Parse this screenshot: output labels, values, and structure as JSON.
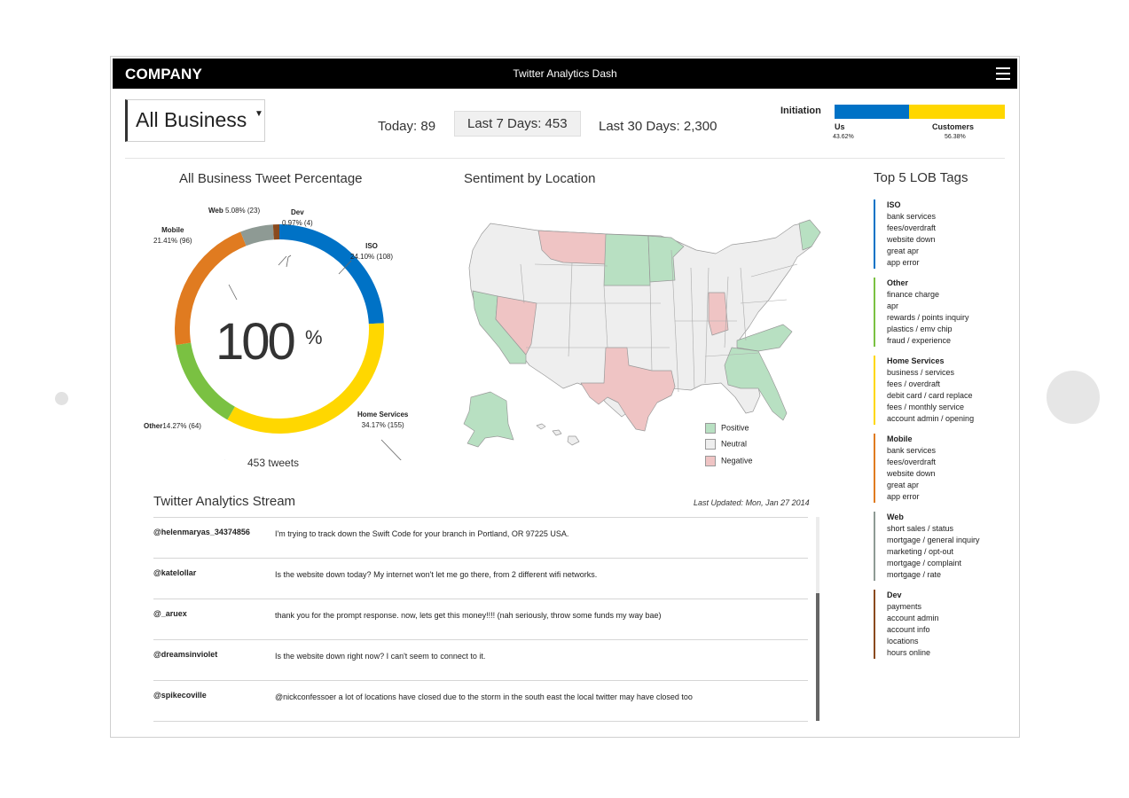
{
  "header": {
    "brand": "COMPANY",
    "title": "Twitter Analytics Dash",
    "menu_icon": "hamburger-menu-icon"
  },
  "business_select": {
    "value": "All Business"
  },
  "ranges": [
    {
      "label": "Today: 89",
      "selected": false
    },
    {
      "label": "Last 7 Days: 453",
      "selected": true
    },
    {
      "label": "Last 30 Days: 2,300",
      "selected": false
    }
  ],
  "initiation": {
    "label": "Initiation",
    "segments": [
      {
        "name": "Us",
        "percent": "43.62%",
        "value": 43.62,
        "color": "#0072c6"
      },
      {
        "name": "Customers",
        "percent": "56.38%",
        "value": 56.38,
        "color": "#ffd700"
      }
    ]
  },
  "donut": {
    "title": "All Business Tweet Percentage",
    "center_value": "100",
    "center_unit": "%",
    "footer": "453 tweets",
    "segments": [
      {
        "name": "ISO",
        "label": "24.10% (108)",
        "value": 24.1,
        "color": "#0072c6"
      },
      {
        "name": "Home Services",
        "label": "34.17% (155)",
        "value": 34.17,
        "color": "#ffd700"
      },
      {
        "name": "Other",
        "label": "14.27% (64)",
        "value": 14.27,
        "color": "#7ac142"
      },
      {
        "name": "Mobile",
        "label": "21.41% (96)",
        "value": 21.41,
        "color": "#e07b20"
      },
      {
        "name": "Web",
        "label": "5.08% (23)",
        "value": 5.08,
        "color": "#8e9a94"
      },
      {
        "name": "Dev",
        "label": "0.97% (4)",
        "value": 0.97,
        "color": "#8a4a1e"
      }
    ]
  },
  "map": {
    "title": "Sentiment by Location",
    "legend": [
      {
        "label": "Positive",
        "color": "#b8e0c2"
      },
      {
        "label": "Neutral",
        "color": "#eeeeee"
      },
      {
        "label": "Negative",
        "color": "#efc4c4"
      }
    ]
  },
  "lob": {
    "title": "Top 5 LOB Tags",
    "groups": [
      {
        "name": "ISO",
        "color": "#0072c6",
        "items": [
          "bank services",
          "fees/overdraft",
          "website down",
          "great apr",
          "app error"
        ]
      },
      {
        "name": "Other",
        "color": "#7ac142",
        "items": [
          "finance charge",
          "apr",
          "rewards / points inquiry",
          "plastics / emv chip",
          "fraud / experience"
        ]
      },
      {
        "name": "Home Services",
        "color": "#ffd700",
        "items": [
          "business / services",
          "fees / overdraft",
          "debit card / card replace",
          "fees / monthly service",
          "account admin / opening"
        ]
      },
      {
        "name": "Mobile",
        "color": "#e07b20",
        "items": [
          "bank services",
          "fees/overdraft",
          "website down",
          "great apr",
          "app error"
        ]
      },
      {
        "name": "Web",
        "color": "#8e9a94",
        "items": [
          "short sales / status",
          "mortgage / general inquiry",
          "marketing / opt-out",
          "mortgage / complaint",
          "mortgage / rate"
        ]
      },
      {
        "name": "Dev",
        "color": "#8a4a1e",
        "items": [
          "payments",
          "account admin",
          "account info",
          "locations",
          "hours online"
        ]
      }
    ]
  },
  "stream": {
    "title": "Twitter Analytics Stream",
    "updated_prefix": "Last Updated:",
    "updated": "Mon, Jan 27 2014",
    "rows": [
      {
        "user": "@helenmaryas_34374856",
        "text": "I'm trying to track down the Swift Code for your branch in Portland, OR 97225 USA."
      },
      {
        "user": "@katelollar",
        "text": "Is the website down today? My internet won't let me go there, from 2 different wifi networks."
      },
      {
        "user": "@_aruex",
        "text": "thank you for the prompt response. now, lets get this money!!!! (nah seriously, throw some funds my way bae)"
      },
      {
        "user": "@dreamsinviolet",
        "text": "Is the website down right now?  I can't seem to connect to it."
      },
      {
        "user": "@spikecoville",
        "text": "@nickconfessoer a lot of locations have closed due to the storm in the south east the local twitter may have closed too"
      }
    ]
  }
}
